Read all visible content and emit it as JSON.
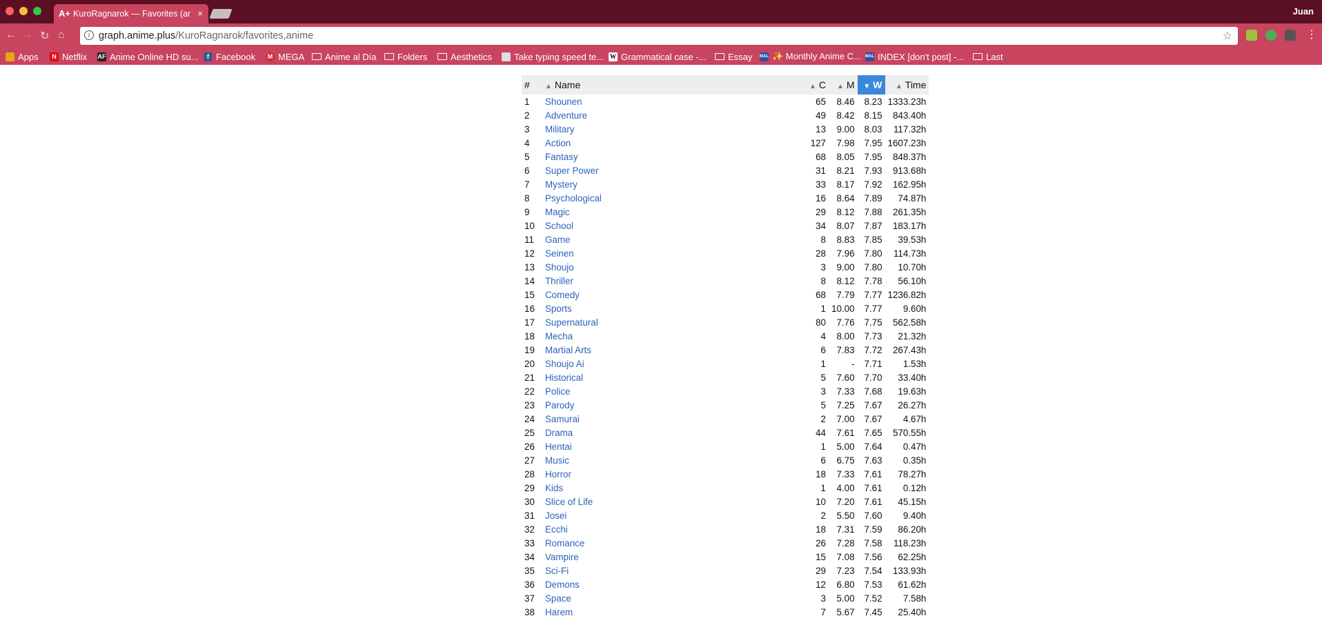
{
  "window": {
    "user": "Juan"
  },
  "tab": {
    "favicon": "A+",
    "title": "KuroRagnarok — Favorites (anime)",
    "close": "×"
  },
  "address_bar": {
    "host": "graph.anime.plus",
    "path": "/KuroRagnarok/favorites,anime"
  },
  "bookmarks": [
    {
      "label": "Apps",
      "icon": "apps-grid-icon",
      "color": "#e8a317"
    },
    {
      "label": "Netflix",
      "icon": "netflix-icon",
      "color": "#e50914"
    },
    {
      "label": "Anime Online HD su...",
      "icon": "af-icon",
      "color": "#222222"
    },
    {
      "label": "Facebook",
      "icon": "facebook-icon",
      "color": "#3b5998"
    },
    {
      "label": "MEGA",
      "icon": "mega-icon",
      "color": "#d9272e"
    },
    {
      "label": "Anime al Día",
      "icon": "folder-icon"
    },
    {
      "label": "Folders",
      "icon": "folder-icon"
    },
    {
      "label": "Aesthetics",
      "icon": "folder-icon"
    },
    {
      "label": "Take typing speed te...",
      "icon": "page-icon",
      "color": "#dddddd"
    },
    {
      "label": "Grammatical case -...",
      "icon": "wikipedia-icon",
      "color": "#ffffff"
    },
    {
      "label": "Essay",
      "icon": "folder-icon"
    },
    {
      "label": "✨ Monthly Anime C...",
      "icon": "mal-icon",
      "color": "#2e51a2"
    },
    {
      "label": "INDEX [don't post] -...",
      "icon": "mal-icon",
      "color": "#2e51a2"
    },
    {
      "label": "Last",
      "icon": "folder-icon"
    }
  ],
  "table": {
    "headers": {
      "rank": "#",
      "name": "Name",
      "c": "C",
      "m": "M",
      "w": "W",
      "time": "Time"
    },
    "sorted_column": "W",
    "rows": [
      {
        "rank": "1",
        "name": "Shounen",
        "c": "65",
        "m": "8.46",
        "w": "8.23",
        "time": "1333.23h"
      },
      {
        "rank": "2",
        "name": "Adventure",
        "c": "49",
        "m": "8.42",
        "w": "8.15",
        "time": "843.40h"
      },
      {
        "rank": "3",
        "name": "Military",
        "c": "13",
        "m": "9.00",
        "w": "8.03",
        "time": "117.32h"
      },
      {
        "rank": "4",
        "name": "Action",
        "c": "127",
        "m": "7.98",
        "w": "7.95",
        "time": "1607.23h"
      },
      {
        "rank": "5",
        "name": "Fantasy",
        "c": "68",
        "m": "8.05",
        "w": "7.95",
        "time": "848.37h"
      },
      {
        "rank": "6",
        "name": "Super Power",
        "c": "31",
        "m": "8.21",
        "w": "7.93",
        "time": "913.68h"
      },
      {
        "rank": "7",
        "name": "Mystery",
        "c": "33",
        "m": "8.17",
        "w": "7.92",
        "time": "162.95h"
      },
      {
        "rank": "8",
        "name": "Psychological",
        "c": "16",
        "m": "8.64",
        "w": "7.89",
        "time": "74.87h"
      },
      {
        "rank": "9",
        "name": "Magic",
        "c": "29",
        "m": "8.12",
        "w": "7.88",
        "time": "261.35h"
      },
      {
        "rank": "10",
        "name": "School",
        "c": "34",
        "m": "8.07",
        "w": "7.87",
        "time": "183.17h"
      },
      {
        "rank": "11",
        "name": "Game",
        "c": "8",
        "m": "8.83",
        "w": "7.85",
        "time": "39.53h"
      },
      {
        "rank": "12",
        "name": "Seinen",
        "c": "28",
        "m": "7.96",
        "w": "7.80",
        "time": "114.73h"
      },
      {
        "rank": "13",
        "name": "Shoujo",
        "c": "3",
        "m": "9.00",
        "w": "7.80",
        "time": "10.70h"
      },
      {
        "rank": "14",
        "name": "Thriller",
        "c": "8",
        "m": "8.12",
        "w": "7.78",
        "time": "56.10h"
      },
      {
        "rank": "15",
        "name": "Comedy",
        "c": "68",
        "m": "7.79",
        "w": "7.77",
        "time": "1236.82h"
      },
      {
        "rank": "16",
        "name": "Sports",
        "c": "1",
        "m": "10.00",
        "w": "7.77",
        "time": "9.60h"
      },
      {
        "rank": "17",
        "name": "Supernatural",
        "c": "80",
        "m": "7.76",
        "w": "7.75",
        "time": "562.58h"
      },
      {
        "rank": "18",
        "name": "Mecha",
        "c": "4",
        "m": "8.00",
        "w": "7.73",
        "time": "21.32h"
      },
      {
        "rank": "19",
        "name": "Martial Arts",
        "c": "6",
        "m": "7.83",
        "w": "7.72",
        "time": "267.43h"
      },
      {
        "rank": "20",
        "name": "Shoujo Ai",
        "c": "1",
        "m": "-",
        "w": "7.71",
        "time": "1.53h"
      },
      {
        "rank": "21",
        "name": "Historical",
        "c": "5",
        "m": "7.60",
        "w": "7.70",
        "time": "33.40h"
      },
      {
        "rank": "22",
        "name": "Police",
        "c": "3",
        "m": "7.33",
        "w": "7.68",
        "time": "19.63h"
      },
      {
        "rank": "23",
        "name": "Parody",
        "c": "5",
        "m": "7.25",
        "w": "7.67",
        "time": "26.27h"
      },
      {
        "rank": "24",
        "name": "Samurai",
        "c": "2",
        "m": "7.00",
        "w": "7.67",
        "time": "4.67h"
      },
      {
        "rank": "25",
        "name": "Drama",
        "c": "44",
        "m": "7.61",
        "w": "7.65",
        "time": "570.55h"
      },
      {
        "rank": "26",
        "name": "Hentai",
        "c": "1",
        "m": "5.00",
        "w": "7.64",
        "time": "0.47h"
      },
      {
        "rank": "27",
        "name": "Music",
        "c": "6",
        "m": "6.75",
        "w": "7.63",
        "time": "0.35h"
      },
      {
        "rank": "28",
        "name": "Horror",
        "c": "18",
        "m": "7.33",
        "w": "7.61",
        "time": "78.27h"
      },
      {
        "rank": "29",
        "name": "Kids",
        "c": "1",
        "m": "4.00",
        "w": "7.61",
        "time": "0.12h"
      },
      {
        "rank": "30",
        "name": "Slice of Life",
        "c": "10",
        "m": "7.20",
        "w": "7.61",
        "time": "45.15h"
      },
      {
        "rank": "31",
        "name": "Josei",
        "c": "2",
        "m": "5.50",
        "w": "7.60",
        "time": "9.40h"
      },
      {
        "rank": "32",
        "name": "Ecchi",
        "c": "18",
        "m": "7.31",
        "w": "7.59",
        "time": "86.20h"
      },
      {
        "rank": "33",
        "name": "Romance",
        "c": "26",
        "m": "7.28",
        "w": "7.58",
        "time": "118.23h"
      },
      {
        "rank": "34",
        "name": "Vampire",
        "c": "15",
        "m": "7.08",
        "w": "7.56",
        "time": "62.25h"
      },
      {
        "rank": "35",
        "name": "Sci-Fi",
        "c": "29",
        "m": "7.23",
        "w": "7.54",
        "time": "133.93h"
      },
      {
        "rank": "36",
        "name": "Demons",
        "c": "12",
        "m": "6.80",
        "w": "7.53",
        "time": "61.62h"
      },
      {
        "rank": "37",
        "name": "Space",
        "c": "3",
        "m": "5.00",
        "w": "7.52",
        "time": "7.58h"
      },
      {
        "rank": "38",
        "name": "Harem",
        "c": "7",
        "m": "5.67",
        "w": "7.45",
        "time": "25.40h"
      }
    ]
  },
  "colors": {
    "titlebar": "#5a1022",
    "toolbar": "#c8445f",
    "link": "#2a64b8",
    "sorted_header": "#3b88d8"
  }
}
